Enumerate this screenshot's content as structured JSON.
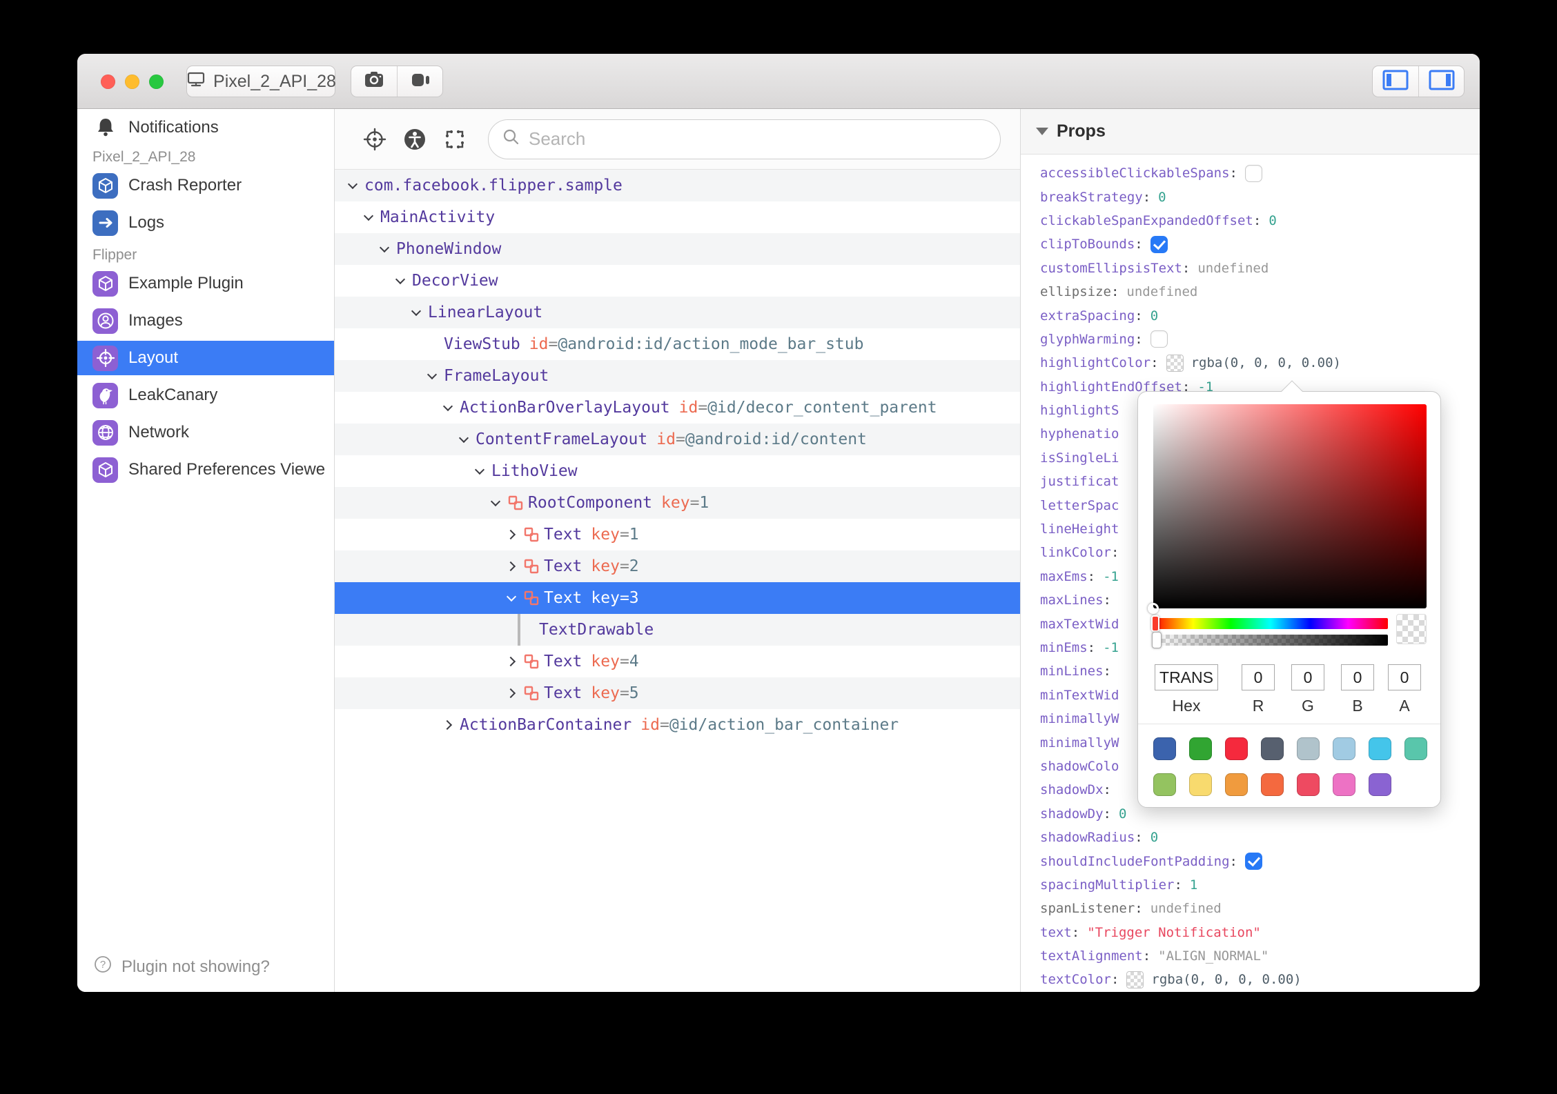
{
  "titlebar": {
    "device_button_label": "Pixel_2_API_28",
    "icon_names": [
      "close-icon",
      "minimize-icon",
      "zoom-icon",
      "monitor-icon",
      "camera-icon",
      "video-camera-icon",
      "left-panel-toggle-icon",
      "right-panel-toggle-icon"
    ]
  },
  "sidebar": {
    "notifications": {
      "label": "Notifications",
      "icon": "bell-icon"
    },
    "section1": {
      "label": "Pixel_2_API_28"
    },
    "section2": {
      "label": "Flipper"
    },
    "items": [
      {
        "label": "Crash Reporter",
        "icon": "cube-icon",
        "color": "#3d6ec0"
      },
      {
        "label": "Logs",
        "icon": "arrow-right-icon",
        "color": "#3d6ec0"
      },
      {
        "label": "Example Plugin",
        "icon": "cube-icon",
        "color": "#8d60d3"
      },
      {
        "label": "Images",
        "icon": "user-circle-icon",
        "color": "#8d60d3"
      },
      {
        "label": "Layout",
        "icon": "target-icon",
        "color": "#8d60d3",
        "selected": true
      },
      {
        "label": "LeakCanary",
        "icon": "bird-icon",
        "color": "#8d60d3"
      },
      {
        "label": "Network",
        "icon": "globe-icon",
        "color": "#8d60d3"
      },
      {
        "label": "Shared Preferences Viewe",
        "icon": "cube-icon",
        "color": "#8d60d3"
      }
    ],
    "footer": {
      "label": "Plugin not showing?",
      "icon": "help-circle-icon"
    }
  },
  "inspector": {
    "toolbar_icons": [
      "target-icon",
      "accessibility-icon",
      "expand-selection-icon"
    ],
    "search": {
      "placeholder": "Search"
    },
    "eq": "=",
    "tree": [
      {
        "name": "com.facebook.flipper.sample"
      },
      {
        "name": "MainActivity"
      },
      {
        "name": "PhoneWindow"
      },
      {
        "name": "DecorView"
      },
      {
        "name": "LinearLayout"
      },
      {
        "name": "ViewStub",
        "attr_name": "id",
        "attr_value": "@android:id/action_mode_bar_stub"
      },
      {
        "name": "FrameLayout"
      },
      {
        "name": "ActionBarOverlayLayout",
        "attr_name": "id",
        "attr_value": "@id/decor_content_parent"
      },
      {
        "name": "ContentFrameLayout",
        "attr_name": "id",
        "attr_value": "@android:id/content"
      },
      {
        "name": "LithoView"
      },
      {
        "name": "RootComponent",
        "attr_name": "key",
        "attr_value": "1"
      },
      {
        "name": "Text",
        "attr_name": "key",
        "attr_value": "1"
      },
      {
        "name": "Text",
        "attr_name": "key",
        "attr_value": "2"
      },
      {
        "name": "Text",
        "attr_name": "key",
        "attr_value": "3",
        "selected": true
      },
      {
        "name": "TextDrawable"
      },
      {
        "name": "Text",
        "attr_name": "key",
        "attr_value": "4"
      },
      {
        "name": "Text",
        "attr_name": "key",
        "attr_value": "5"
      },
      {
        "name": "ActionBarContainer",
        "attr_name": "id",
        "attr_value": "@id/action_bar_container"
      }
    ]
  },
  "props": {
    "title": "Props",
    "colon": ":",
    "rows": [
      {
        "key": "accessibleClickableSpans",
        "checkbox": "unchecked"
      },
      {
        "key": "breakStrategy",
        "value": "0"
      },
      {
        "key": "clickableSpanExpandedOffset",
        "value": "0"
      },
      {
        "key": "clipToBounds",
        "checkbox": "checked"
      },
      {
        "key": "customEllipsisText",
        "value": "undefined"
      },
      {
        "key": "ellipsize",
        "value": "undefined"
      },
      {
        "key": "extraSpacing",
        "value": "0"
      },
      {
        "key": "glyphWarming",
        "checkbox": "unchecked"
      },
      {
        "key": "highlightColor",
        "value": "rgba(0, 0, 0, 0.00)",
        "swatch": true
      },
      {
        "key": "highlightEndOffset",
        "value": "-1"
      },
      {
        "key": "highlightS"
      },
      {
        "key": "hyphenatio"
      },
      {
        "key": "isSingleLi"
      },
      {
        "key": "justificat"
      },
      {
        "key": "letterSpac"
      },
      {
        "key": "lineHeight"
      },
      {
        "key": "linkColor"
      },
      {
        "key": "maxEms",
        "value": "-1"
      },
      {
        "key": "maxLines"
      },
      {
        "key": "maxTextWid"
      },
      {
        "key": "minEms",
        "value": "-1"
      },
      {
        "key": "minLines"
      },
      {
        "key": "minTextWid"
      },
      {
        "key": "minimallyW"
      },
      {
        "key": "minimallyW"
      },
      {
        "key": "shadowColo"
      },
      {
        "key": "shadowDx"
      },
      {
        "key": "shadowDy",
        "value": "0"
      },
      {
        "key": "shadowRadius",
        "value": "0"
      },
      {
        "key": "shouldIncludeFontPadding",
        "checkbox": "checked"
      },
      {
        "key": "spacingMultiplier",
        "value": "1"
      },
      {
        "key": "spanListener",
        "value": "undefined"
      },
      {
        "key": "text",
        "value": "\"Trigger Notification\""
      },
      {
        "key": "textAlignment",
        "value": "\"ALIGN_NORMAL\""
      },
      {
        "key": "textColor",
        "value": "rgba(0, 0, 0, 0.00)",
        "swatch": true
      }
    ]
  },
  "color_picker": {
    "hex": "TRANS",
    "r": "0",
    "g": "0",
    "b": "0",
    "a": "0",
    "labels": {
      "hex": "Hex",
      "r": "R",
      "g": "G",
      "b": "B",
      "a": "A"
    },
    "presets_row1": [
      "#3b63ad",
      "#31a532",
      "#f5293d",
      "#57606f",
      "#b0c3cb",
      "#a1cbe3",
      "#44c5ea",
      "#59c6ab"
    ],
    "presets_row2": [
      "#94c360",
      "#f8da6e",
      "#f09b3e",
      "#f4693f",
      "#ee4a61",
      "#ed72c4",
      "#8a63d2"
    ]
  }
}
